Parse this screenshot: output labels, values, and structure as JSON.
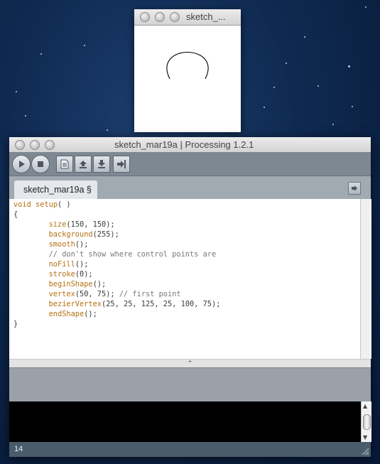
{
  "sketch_window": {
    "title": "sketch_...",
    "canvas_background": "#ffffff",
    "shape_color": "#000000"
  },
  "main_window": {
    "title": "sketch_mar19a | Processing 1.2.1",
    "toolbar": {
      "run_icon": "play-icon",
      "stop_icon": "stop-icon",
      "new_icon": "new-file-icon",
      "open_icon": "open-arrow-up-icon",
      "save_icon": "save-arrow-down-icon",
      "export_icon": "export-arrow-icon"
    },
    "tab": {
      "label": "sketch_mar19a §"
    },
    "tab_menu_icon": "tab-menu-arrow-icon",
    "divider_label": "⌃",
    "status": {
      "line_number": "14"
    },
    "colors": {
      "keyword": "#b67110",
      "comment": "#777777",
      "toolbar": "#7e8893",
      "tabbar": "#a1a9b1",
      "status_bar": "#4a5b6a"
    }
  },
  "code": {
    "l1": {
      "kw": "void",
      "fn": "setup",
      "rest": "( )"
    },
    "l2": "{",
    "l3": {
      "fn": "size",
      "rest": "(150, 150);"
    },
    "l4": {
      "fn": "background",
      "rest": "(255);"
    },
    "l5": {
      "fn": "smooth",
      "rest": "();"
    },
    "l6": "// don't show where control points are",
    "l7": {
      "fn": "noFill",
      "rest": "();"
    },
    "l8": {
      "fn": "stroke",
      "rest": "(0);"
    },
    "l9": {
      "fn": "beginShape",
      "rest": "();"
    },
    "l10": {
      "fn": "vertex",
      "rest": "(50, 75); ",
      "comment": "// first point"
    },
    "l11": {
      "fn": "bezierVertex",
      "rest": "(25, 25, 125, 25, 100, 75);"
    },
    "l12": {
      "fn": "endShape",
      "rest": "();"
    },
    "l13": "}"
  }
}
